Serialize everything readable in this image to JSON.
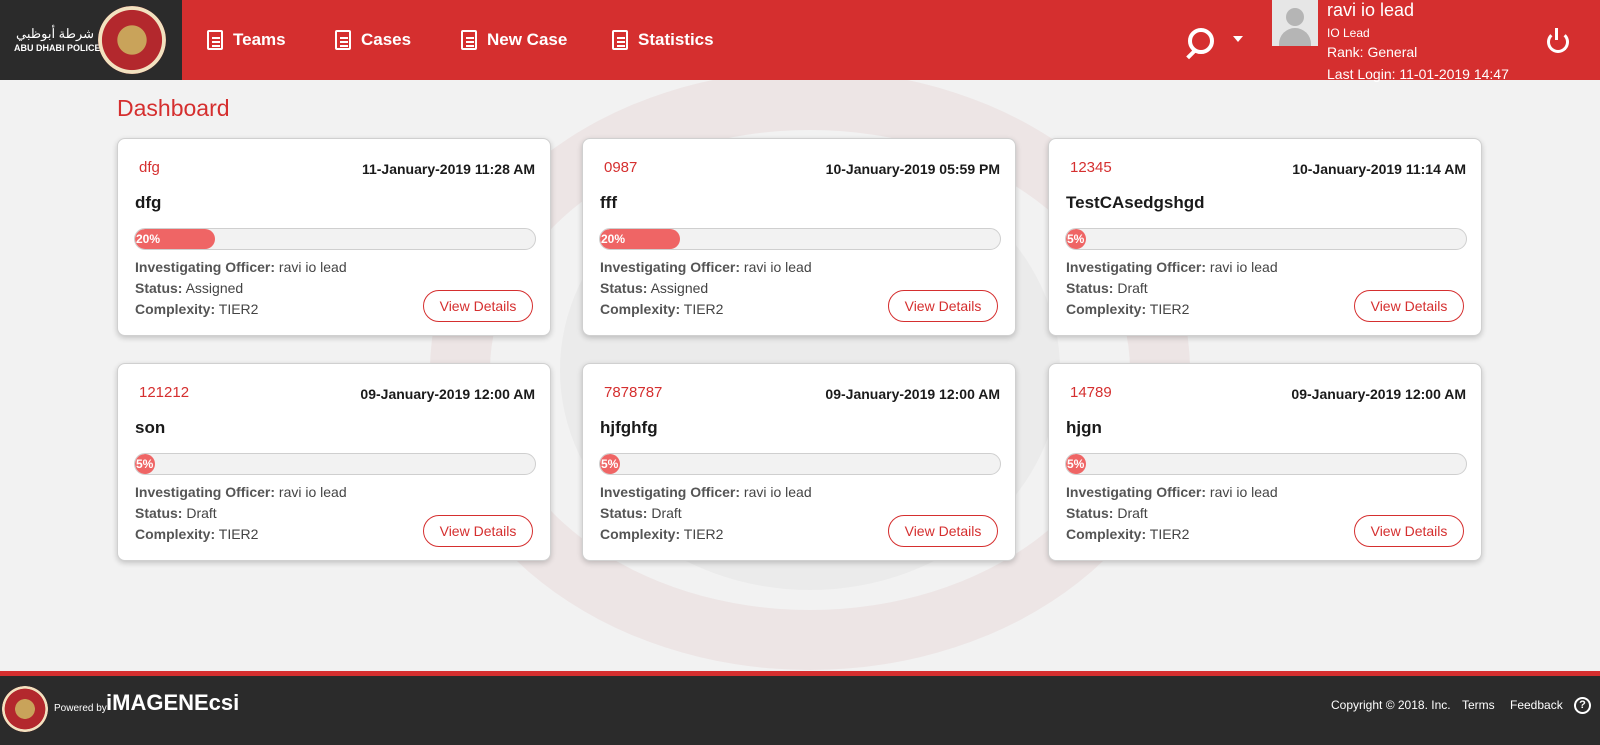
{
  "brand": {
    "logo_arabic": "شرطة أبوظبي",
    "logo_english": "ABU DHABI POLICE"
  },
  "nav": {
    "items": [
      {
        "label": "Teams",
        "icon": "teams-icon"
      },
      {
        "label": "Cases",
        "icon": "cases-icon"
      },
      {
        "label": "New Case",
        "icon": "new-case-icon"
      },
      {
        "label": "Statistics",
        "icon": "statistics-icon"
      }
    ]
  },
  "user": {
    "name": "ravi io lead",
    "role": "IO Lead",
    "rank": "Rank: General",
    "last_login": "Last Login: 11-01-2019 14:47"
  },
  "page": {
    "title": "Dashboard"
  },
  "labels": {
    "officer": "Investigating Officer:",
    "status": "Status:",
    "complexity": "Complexity:",
    "view_details": "View Details"
  },
  "cases": [
    {
      "id": "dfg",
      "date": "11-January-2019 11:28 AM",
      "title": "dfg",
      "progress": 20,
      "progress_label": "20%",
      "officer": "ravi io lead",
      "status": "Assigned",
      "complexity": "TIER2"
    },
    {
      "id": "0987",
      "date": "10-January-2019 05:59 PM",
      "title": "fff",
      "progress": 20,
      "progress_label": "20%",
      "officer": "ravi io lead",
      "status": "Assigned",
      "complexity": "TIER2"
    },
    {
      "id": "12345",
      "date": "10-January-2019 11:14 AM",
      "title": "TestCAsedgshgd",
      "progress": 5,
      "progress_label": "5%",
      "officer": "ravi io lead",
      "status": "Draft",
      "complexity": "TIER2"
    },
    {
      "id": "121212",
      "date": "09-January-2019 12:00 AM",
      "title": "son",
      "progress": 5,
      "progress_label": "5%",
      "officer": "ravi io lead",
      "status": "Draft",
      "complexity": "TIER2"
    },
    {
      "id": "7878787",
      "date": "09-January-2019 12:00 AM",
      "title": "hjfghfg",
      "progress": 5,
      "progress_label": "5%",
      "officer": "ravi io lead",
      "status": "Draft",
      "complexity": "TIER2"
    },
    {
      "id": "14789",
      "date": "09-January-2019 12:00 AM",
      "title": "hjgn",
      "progress": 5,
      "progress_label": "5%",
      "officer": "ravi io lead",
      "status": "Draft",
      "complexity": "TIER2"
    }
  ],
  "footer": {
    "powered_by": "Powered by",
    "brand": "iMAGENEcsi",
    "copyright": "Copyright © 2018. Inc.",
    "terms": "Terms",
    "feedback": "Feedback",
    "help": "?"
  },
  "colors": {
    "primary": "#d52f2f",
    "dark": "#2b2b2b",
    "progress": "#ef6565"
  }
}
